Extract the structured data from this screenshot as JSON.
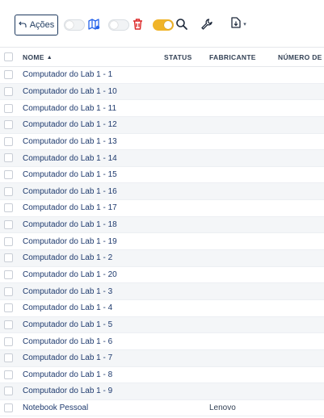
{
  "toolbar": {
    "actions_label": "Ações",
    "icons": [
      "undo-arrow-icon",
      "map-icon",
      "trash-icon",
      "search-icon",
      "wrench-icon",
      "export-icon",
      "chevron-down-icon"
    ],
    "toggle_states": [
      false,
      false,
      true
    ]
  },
  "table": {
    "columns": [
      "NOME",
      "STATUS",
      "FABRICANTE",
      "NÚMERO DE"
    ],
    "sort_column": "NOME",
    "rows": [
      {
        "name": "Computador do Lab 1 - 1",
        "status": "",
        "fabricante": ""
      },
      {
        "name": "Computador do Lab 1 - 10",
        "status": "",
        "fabricante": ""
      },
      {
        "name": "Computador do Lab 1 - 11",
        "status": "",
        "fabricante": ""
      },
      {
        "name": "Computador do Lab 1 - 12",
        "status": "",
        "fabricante": ""
      },
      {
        "name": "Computador do Lab 1 - 13",
        "status": "",
        "fabricante": ""
      },
      {
        "name": "Computador do Lab 1 - 14",
        "status": "",
        "fabricante": ""
      },
      {
        "name": "Computador do Lab 1 - 15",
        "status": "",
        "fabricante": ""
      },
      {
        "name": "Computador do Lab 1 - 16",
        "status": "",
        "fabricante": ""
      },
      {
        "name": "Computador do Lab 1 - 17",
        "status": "",
        "fabricante": ""
      },
      {
        "name": "Computador do Lab 1 - 18",
        "status": "",
        "fabricante": ""
      },
      {
        "name": "Computador do Lab 1 - 19",
        "status": "",
        "fabricante": ""
      },
      {
        "name": "Computador do Lab 1 - 2",
        "status": "",
        "fabricante": ""
      },
      {
        "name": "Computador do Lab 1 - 20",
        "status": "",
        "fabricante": ""
      },
      {
        "name": "Computador do Lab 1 - 3",
        "status": "",
        "fabricante": ""
      },
      {
        "name": "Computador do Lab 1 - 4",
        "status": "",
        "fabricante": ""
      },
      {
        "name": "Computador do Lab 1 - 5",
        "status": "",
        "fabricante": ""
      },
      {
        "name": "Computador do Lab 1 - 6",
        "status": "",
        "fabricante": ""
      },
      {
        "name": "Computador do Lab 1 - 7",
        "status": "",
        "fabricante": ""
      },
      {
        "name": "Computador do Lab 1 - 8",
        "status": "",
        "fabricante": ""
      },
      {
        "name": "Computador do Lab 1 - 9",
        "status": "",
        "fabricante": ""
      },
      {
        "name": "Notebook Pessoal",
        "status": "",
        "fabricante": "Lenovo"
      }
    ]
  },
  "colors": {
    "link": "#1e3a6e",
    "accent_toggle": "#f0b429",
    "trash": "#dc2626",
    "map": "#2563eb",
    "stripe": "#f4f6f8"
  }
}
